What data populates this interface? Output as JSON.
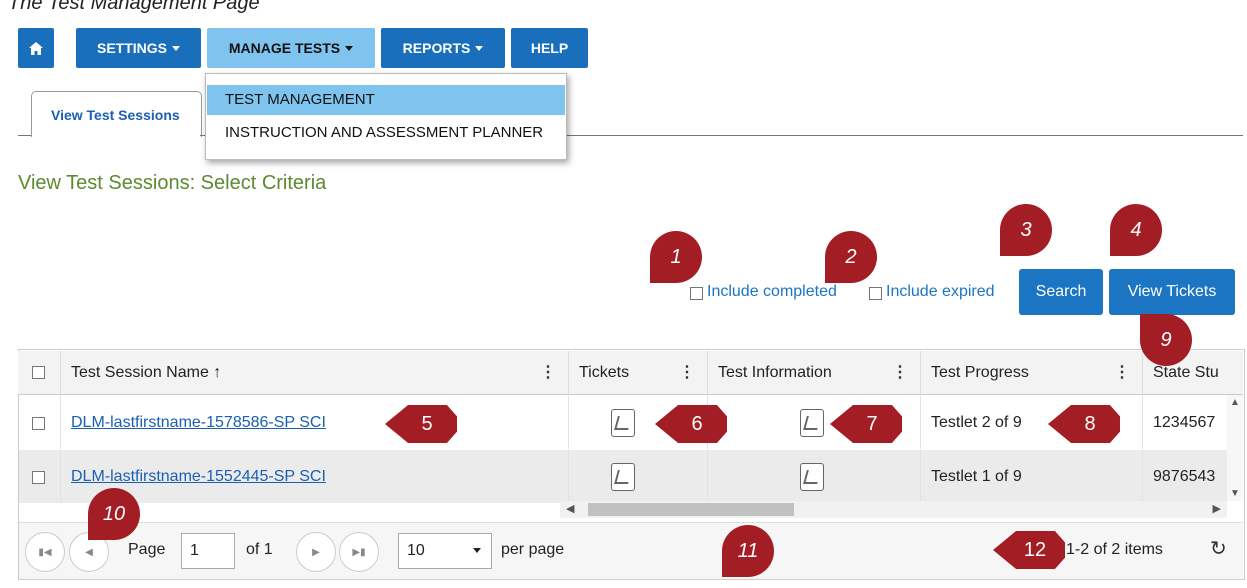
{
  "caption": "The Test Management Page",
  "nav": {
    "home_icon": "home-icon",
    "settings": "SETTINGS",
    "manage_tests": "MANAGE TESTS",
    "reports": "REPORTS",
    "help": "HELP"
  },
  "dropdown": {
    "items": [
      "TEST MANAGEMENT",
      "INSTRUCTION AND ASSESSMENT PLANNER"
    ]
  },
  "tab": {
    "label": "View Test Sessions"
  },
  "section_title": "View Test Sessions: Select Criteria",
  "filters": {
    "include_completed": "Include completed",
    "include_expired": "Include expired"
  },
  "buttons": {
    "search": "Search",
    "view_tickets": "View Tickets"
  },
  "table": {
    "columns": [
      "Test Session Name ↑",
      "Tickets",
      "Test Information",
      "Test Progress",
      "State Stu"
    ],
    "rows": [
      {
        "name": "DLM-lastfirstname-1578586-SP SCI",
        "progress": "Testlet 2 of 9",
        "state_id": "1234567"
      },
      {
        "name": "DLM-lastfirstname-1552445-SP SCI",
        "progress": "Testlet 1 of 9",
        "state_id": "9876543"
      }
    ]
  },
  "pager": {
    "page_label": "Page",
    "page_value": "1",
    "of_label": "of 1",
    "page_size": "10",
    "per_page": "per page",
    "items_summary": "1-2 of 2 items"
  },
  "callouts": [
    "1",
    "2",
    "3",
    "4",
    "5",
    "6",
    "7",
    "8",
    "9",
    "10",
    "11",
    "12"
  ],
  "colors": {
    "nav_blue": "#1a6fbd",
    "nav_active": "#7ec4ee",
    "callout_red": "#a31d24",
    "title_green": "#5c8a2e"
  }
}
